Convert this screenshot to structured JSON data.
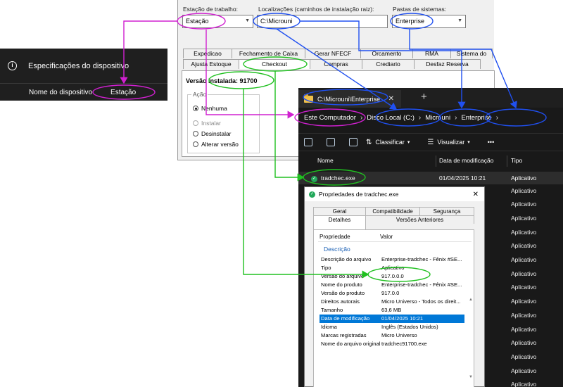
{
  "device": {
    "title": "Especificações do dispositivo",
    "name_label": "Nome do dispositivo",
    "name_value": "Estação"
  },
  "installer": {
    "workstation_label": "Estação de trabalho:",
    "workstation_value": "Estação",
    "locations_label": "Localizações (caminhos de instalação raiz):",
    "locations_value": "C:\\Microuni",
    "systems_label": "Pastas de sistemas:",
    "systems_value": "Enterprise",
    "tabs_top": [
      "Expedicao",
      "Fechamento de Caixa",
      "Gerar NFECF",
      "Orcamento",
      "RMA",
      "Sistema do"
    ],
    "tabs_bottom": [
      "Ajusta Estoque",
      "Checkout",
      "Compras",
      "Crediario",
      "Desfaz Reserva"
    ],
    "version": "Versão Instalada: 91700",
    "action_legend": "Ação",
    "actions": [
      "Nenhuma",
      "Instalar",
      "Desinstalar",
      "Alterar versão"
    ]
  },
  "explorer": {
    "tab_title": "C:\\Microuni\\Enterprise",
    "close_glyph": "✕",
    "new_tab_glyph": "+",
    "breadcrumb": [
      "Este Computador",
      "Disco Local (C:)",
      "Microuni",
      "Enterprise"
    ],
    "breadcrumb_sep": "›",
    "toolbar": {
      "sort": "Classificar",
      "view": "Visualizar",
      "more": "•••"
    },
    "columns": {
      "name": "Nome",
      "modified": "Data de modificação",
      "type": "Tipo"
    },
    "file": {
      "name": "tradchec.exe",
      "modified": "01/04/2025 10:21",
      "type": "Aplicativo"
    },
    "type_rows": [
      "Aplicativo",
      "Aplicativo",
      "Aplicativo",
      "Aplicativo",
      "Aplicativo",
      "Aplicativo",
      "Aplicativo",
      "Aplicativo",
      "Aplicativo",
      "Aplicativo",
      "Aplicativo",
      "Aplicativo",
      "Aplicativo",
      "Aplicativo",
      "Aplicativo"
    ]
  },
  "props": {
    "title": "Propriedades de tradchec.exe",
    "close_glyph": "✕",
    "tabs": [
      "Geral",
      "Compatibilidade",
      "Segurança",
      "Detalhes",
      "Versões Anteriores"
    ],
    "header": {
      "property": "Propriedade",
      "value": "Valor"
    },
    "group": "Descrição",
    "rows": [
      {
        "prop": "Descrição do arquivo",
        "val": "Enterprise-tradchec - Fênix #SE..."
      },
      {
        "prop": "Tipo",
        "val": "Aplicativo"
      },
      {
        "prop": "Versão do arquivo",
        "val": "917.0.0.0"
      },
      {
        "prop": "Nome do produto",
        "val": "Enterprise-tradchec - Fênix #SE..."
      },
      {
        "prop": "Versão do produto",
        "val": "917.0.0"
      },
      {
        "prop": "Direitos autorais",
        "val": "Micro Universo - Todos os direit..."
      },
      {
        "prop": "Tamanho",
        "val": "63,6 MB"
      },
      {
        "prop": "Data de modificação",
        "val": "01/04/2025 10:21"
      },
      {
        "prop": "Idioma",
        "val": "Inglês (Estados Unidos)"
      },
      {
        "prop": "Marcas registradas",
        "val": "Micro Universo"
      },
      {
        "prop": "Nome do arquivo original",
        "val": "tradchec91700.exe"
      }
    ]
  },
  "annotation_colors": {
    "magenta": "#d020d0",
    "blue": "#2050f0",
    "green": "#20c020",
    "selection": "#0078d7"
  }
}
